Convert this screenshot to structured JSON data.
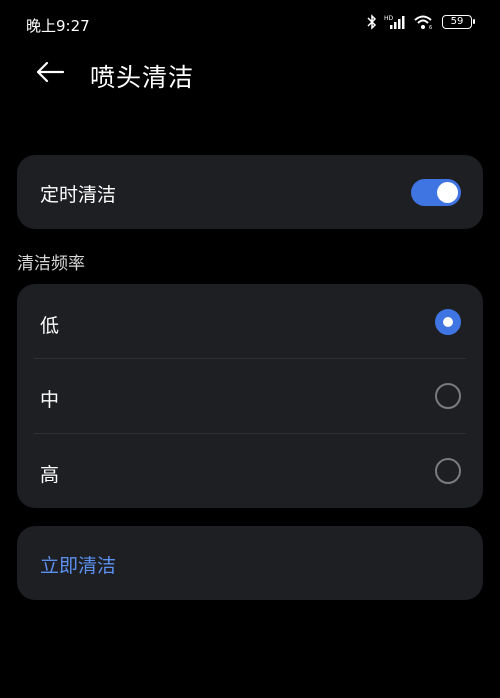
{
  "status_bar": {
    "time": "晚上9:27",
    "battery": "59",
    "icons": [
      "bluetooth-icon",
      "hd-signal-icon",
      "wifi-icon",
      "battery-icon"
    ]
  },
  "header": {
    "back_icon": "back-arrow-icon",
    "title": "喷头清洁"
  },
  "timer_clean": {
    "label": "定时清洁",
    "enabled": true
  },
  "frequency": {
    "section_label": "清洁频率",
    "options": [
      {
        "label": "低",
        "selected": true
      },
      {
        "label": "中",
        "selected": false
      },
      {
        "label": "高",
        "selected": false
      }
    ]
  },
  "action": {
    "label": "立即清洁"
  },
  "colors": {
    "background": "#000000",
    "card": "#1e1f22",
    "accent": "#3f74e3",
    "action_text": "#5b8ff0"
  }
}
